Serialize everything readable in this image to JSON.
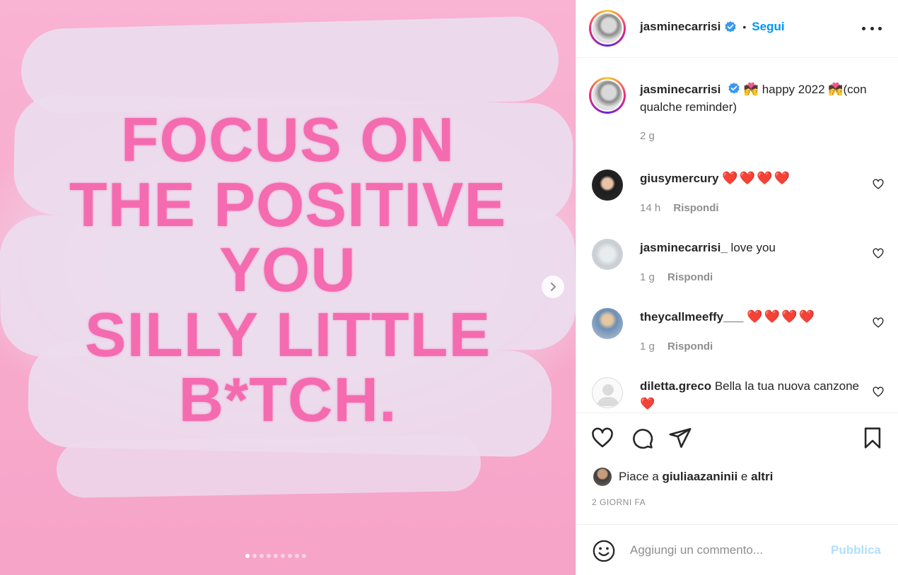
{
  "media": {
    "quote_lines": [
      "FOCUS ON",
      "THE POSITIVE",
      "YOU",
      "SILLY LITTLE",
      "B*TCH."
    ],
    "carousel_dots": 9,
    "active_dot": 0,
    "colors": {
      "background_pink": "#f6a4c8",
      "text_pink": "#f56bb0",
      "paint_white": "#ecdcee"
    }
  },
  "header": {
    "username": "jasminecarrisi",
    "verified": true,
    "separator": "•",
    "follow_label": "Segui",
    "more_icon": "more-horizontal-icon"
  },
  "caption": {
    "username": "jasminecarrisi",
    "text": "💏 happy 2022 💏(con qualche reminder)",
    "time": "2 g"
  },
  "comments": [
    {
      "username": "giusymercury",
      "text": "❤️❤️❤️❤️",
      "time": "14 h",
      "reply_label": "Rispondi"
    },
    {
      "username": "jasminecarrisi_",
      "text": "love you",
      "time": "1 g",
      "reply_label": "Rispondi"
    },
    {
      "username": "theycallmeeffy___",
      "text": "❤️❤️❤️❤️",
      "time": "1 g",
      "reply_label": "Rispondi"
    },
    {
      "username": "diletta.greco",
      "text": "Bella la tua nuova canzone❤️",
      "time": "",
      "reply_label": ""
    }
  ],
  "likes": {
    "prefix": "Piace a",
    "user": "giuliaazaninii",
    "connector": "e",
    "others": "altri"
  },
  "post_date": "2 GIORNI FA",
  "composer": {
    "placeholder": "Aggiungi un commento...",
    "publish_label": "Pubblica"
  },
  "colors": {
    "link_blue": "#0095f6",
    "muted": "#8e8e8e",
    "publish_disabled": "#b2dffc"
  }
}
